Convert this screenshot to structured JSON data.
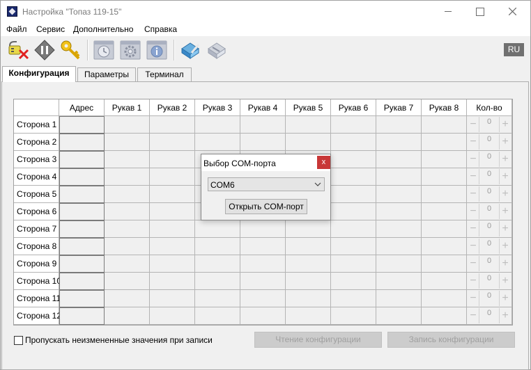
{
  "window": {
    "title": "Настройка \"Топаз 119-15\""
  },
  "menu": [
    "Файл",
    "Сервис",
    "Дополнительно",
    "Справка"
  ],
  "toolbar": {
    "icons": [
      "disconnect-cable-icon",
      "connect-icon",
      "key-icon",
      "clock-icon",
      "gear-icon",
      "info-icon",
      "write-device-icon",
      "read-device-icon"
    ],
    "language": "RU"
  },
  "tabs": [
    "Конфигурация",
    "Параметры",
    "Терминал"
  ],
  "grid": {
    "columns": [
      "Адрес",
      "Рукав 1",
      "Рукав 2",
      "Рукав 3",
      "Рукав 4",
      "Рукав 5",
      "Рукав 6",
      "Рукав 7",
      "Рукав 8",
      "Кол-во"
    ],
    "rows": [
      {
        "label": "Сторона 1",
        "qty": "0"
      },
      {
        "label": "Сторона 2",
        "qty": "0"
      },
      {
        "label": "Сторона 3",
        "qty": "0"
      },
      {
        "label": "Сторона 4",
        "qty": "0"
      },
      {
        "label": "Сторона 5",
        "qty": "0"
      },
      {
        "label": "Сторона 6",
        "qty": "0"
      },
      {
        "label": "Сторона 7",
        "qty": "0"
      },
      {
        "label": "Сторона 8",
        "qty": "0"
      },
      {
        "label": "Сторона 9",
        "qty": "0"
      },
      {
        "label": "Сторона 10",
        "qty": "0"
      },
      {
        "label": "Сторона 11",
        "qty": "0"
      },
      {
        "label": "Сторона 12",
        "qty": "0"
      }
    ],
    "stepper_minus": "−",
    "stepper_plus": "+"
  },
  "footer": {
    "skip_unchanged_label": "Пропускать неизмененные значения при записи",
    "read_config_label": "Чтение конфигурации",
    "write_config_label": "Запись конфигурации"
  },
  "com_dialog": {
    "title": "Выбор COM-порта",
    "close_label": "x",
    "selected_port": "COM6",
    "open_button_label": "Открыть COM-порт"
  }
}
